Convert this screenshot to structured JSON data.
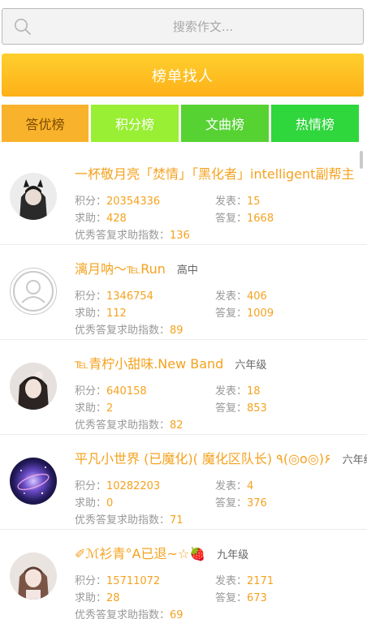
{
  "search": {
    "placeholder": "搜索作文..."
  },
  "rank_button": {
    "label": "榜单找人"
  },
  "tabs": [
    {
      "label": "答优榜"
    },
    {
      "label": "积分榜"
    },
    {
      "label": "文曲榜"
    },
    {
      "label": "热情榜"
    }
  ],
  "stat_labels": {
    "points": "积分：",
    "posts": "发表：",
    "help": "求助：",
    "replies": "答复：",
    "index": "优秀答复求助指数："
  },
  "users": [
    {
      "name": "一杯敬月亮「焚情」「黑化者」intelligent副帮主",
      "grade": "",
      "points": "20354336",
      "posts": "15",
      "help": "428",
      "replies": "1668",
      "index": "136"
    },
    {
      "name": "漓月呐～℡Run",
      "grade": "高中",
      "points": "1346754",
      "posts": "406",
      "help": "112",
      "replies": "1009",
      "index": "89"
    },
    {
      "name": "℡青柠小甜味.New Band",
      "grade": "六年级",
      "points": "640158",
      "posts": "18",
      "help": "2",
      "replies": "853",
      "index": "82"
    },
    {
      "name": "平凡小世界 (已魔化)( 魔化区队长) ٩(◎o◎)۶",
      "grade": "六年级",
      "points": "10282203",
      "posts": "4",
      "help": "0",
      "replies": "376",
      "index": "71"
    },
    {
      "name": "✐ℳ衫青°A已退~☆🍓",
      "grade": "九年级",
      "points": "15711072",
      "posts": "2171",
      "help": "28",
      "replies": "673",
      "index": "69"
    }
  ]
}
